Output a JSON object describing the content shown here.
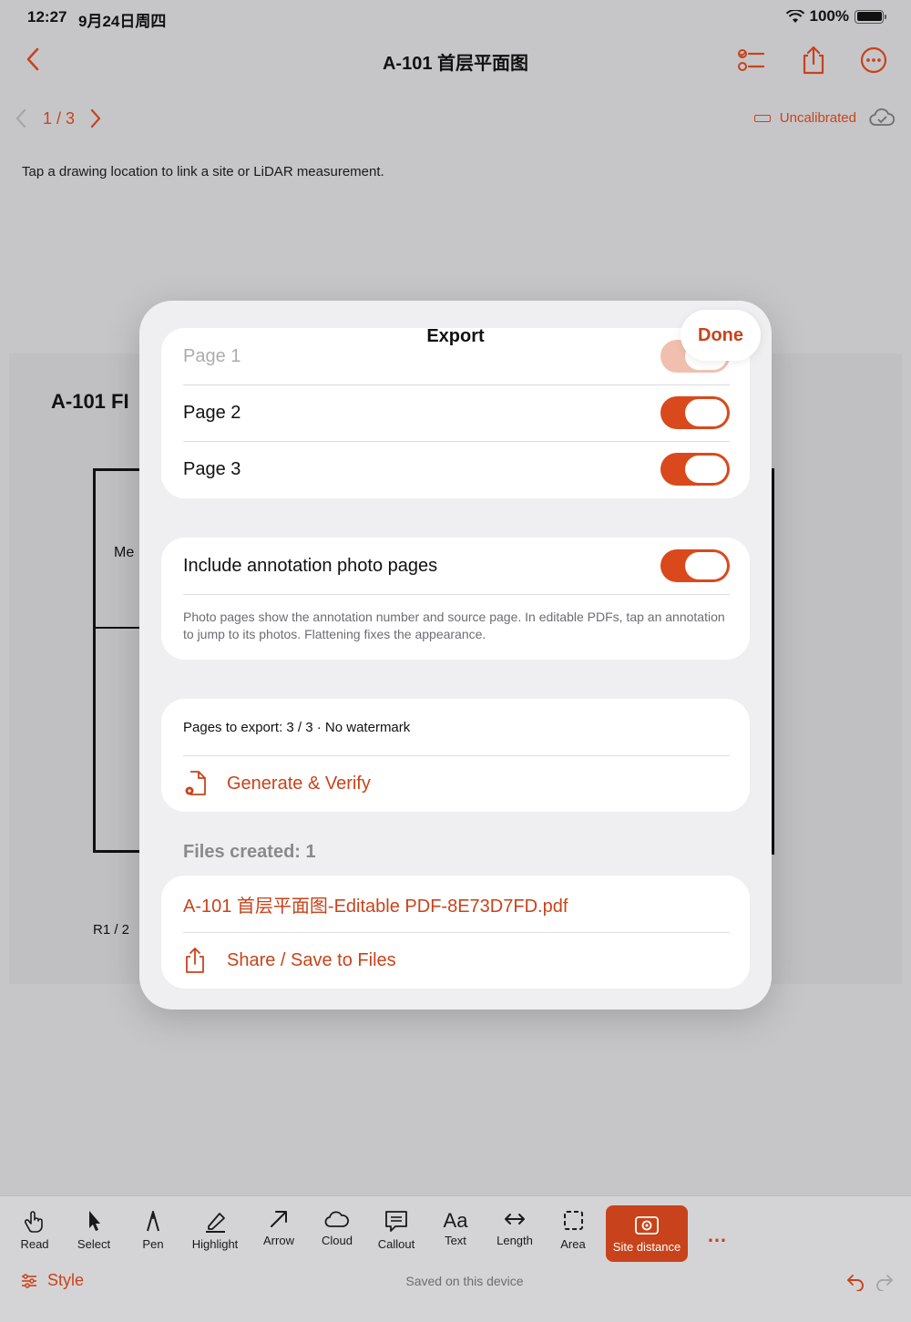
{
  "status": {
    "time": "12:27",
    "date": "9月24日周四",
    "battery": "100%"
  },
  "nav": {
    "title": "A-101 首层平面图"
  },
  "pager": {
    "label": "1 / 3"
  },
  "calibration": {
    "label": "Uncalibrated"
  },
  "hint": "Tap a drawing location to link a site or LiDAR measurement.",
  "sheet": {
    "title": "A-101 FI",
    "room": "Me",
    "footer": "R1  /  2"
  },
  "modal": {
    "title": "Export",
    "done": "Done",
    "pages": [
      {
        "label": "Page 1",
        "on": true
      },
      {
        "label": "Page 2",
        "on": true
      },
      {
        "label": "Page 3",
        "on": true
      }
    ],
    "photo_pages": {
      "label": "Include annotation photo pages",
      "on": true,
      "note": "Photo pages show the annotation number and source page. In editable PDFs, tap an annotation to jump to its photos. Flattening fixes the appearance."
    },
    "summary": "Pages to export: 3 / 3 · No watermark",
    "generate": "Generate & Verify",
    "files_created": "Files created: 1",
    "file_name": "A-101 首层平面图-Editable PDF-8E73D7FD.pdf",
    "share": "Share / Save to Files"
  },
  "toolbar": {
    "tools": [
      {
        "label": "Read",
        "icon": "hand-icon"
      },
      {
        "label": "Select",
        "icon": "cursor-icon"
      },
      {
        "label": "Pen",
        "icon": "pen-nib-icon"
      },
      {
        "label": "Highlight",
        "icon": "highlighter-icon"
      },
      {
        "label": "Arrow",
        "icon": "arrow-icon"
      },
      {
        "label": "Cloud",
        "icon": "cloud-icon"
      },
      {
        "label": "Callout",
        "icon": "callout-icon"
      },
      {
        "label": "Text",
        "icon": "text-aa-icon"
      },
      {
        "label": "Length",
        "icon": "length-icon"
      },
      {
        "label": "Area",
        "icon": "area-icon"
      }
    ],
    "active_tool": "Site distance",
    "more": "…",
    "style": "Style",
    "saved": "Saved on this device"
  },
  "colors": {
    "accent": "#c8431b",
    "toggle_on": "#d9491c"
  }
}
